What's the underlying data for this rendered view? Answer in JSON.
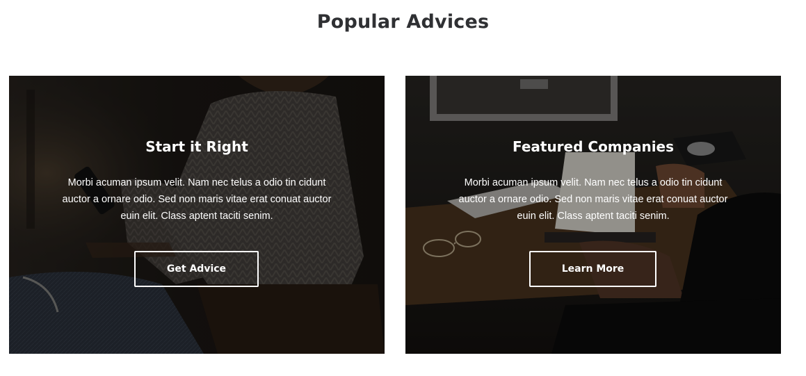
{
  "section": {
    "title": "Popular Advices"
  },
  "cards": [
    {
      "title": "Start it Right",
      "text": "Morbi acuman ipsum velit. Nam nec telus a odio tin cidunt auctor a ornare odio. Sed non maris vitae erat conuat auctor euin elit. Class aptent taciti senim.",
      "button_label": "Get Advice",
      "background": "photo-woman-sweater-smartphone"
    },
    {
      "title": "Featured Companies",
      "text": "Morbi acuman ipsum velit. Nam nec telus a odio tin cidunt auctor a ornare odio. Sed non maris vitae erat conuat auctor euin elit. Class aptent taciti senim.",
      "button_label": "Learn More",
      "background": "photo-desk-computer-notebook-glasses"
    }
  ],
  "colors": {
    "title_text": "#2f3033",
    "card_text": "#ffffff",
    "page_background": "#ffffff"
  }
}
